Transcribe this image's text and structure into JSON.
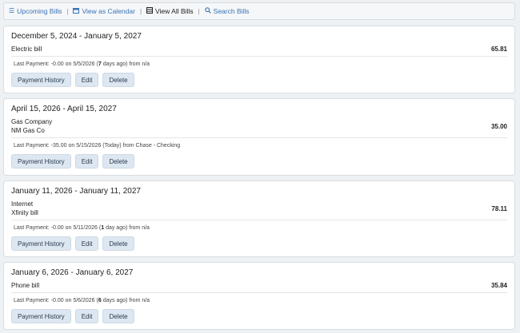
{
  "nav": {
    "upcoming": {
      "icon": "list-icon",
      "label": "Upcoming Bills"
    },
    "calendar": {
      "icon": "calendar-icon",
      "label": "View as Calendar"
    },
    "all": {
      "icon": "table-icon",
      "label": "View All Bills"
    },
    "search": {
      "icon": "search-icon",
      "label": "Search Bills"
    }
  },
  "buttons": {
    "history": "Payment History",
    "edit": "Edit",
    "delete": "Delete"
  },
  "bills": [
    {
      "title": "December 5, 2024 - January 5, 2027",
      "line1": "Electric bill",
      "line2": "",
      "amount": "65.81",
      "last_prefix": "Last Payment: -0.00 on 5/5/2026 (",
      "last_bold": "7",
      "last_suffix": " days ago) from n/a"
    },
    {
      "title": "April 15, 2026 - April 15, 2027",
      "line1": "Gas Company",
      "line2": "NM Gas Co",
      "amount": "35.00",
      "last_prefix": "Last Payment: -35.00 on 5/15/2026 (Today) from Chase - Checking",
      "last_bold": "",
      "last_suffix": ""
    },
    {
      "title": "January 11, 2026 - January 11, 2027",
      "line1": "Internet",
      "line2": "Xfinity bill",
      "amount": "78.11",
      "last_prefix": "Last Payment: -0.00 on 5/11/2026 (",
      "last_bold": "1",
      "last_suffix": " day ago) from n/a"
    },
    {
      "title": "January 6, 2026 - January 6, 2027",
      "line1": "Phone bill",
      "line2": "",
      "amount": "35.84",
      "last_prefix": "Last Payment: -0.00 on 5/6/2026 (",
      "last_bold": "6",
      "last_suffix": " days ago) from n/a"
    }
  ],
  "colors": {
    "link": "#3a72b8",
    "button_bg": "#dde7f1",
    "page_bg": "#eef1f3"
  }
}
